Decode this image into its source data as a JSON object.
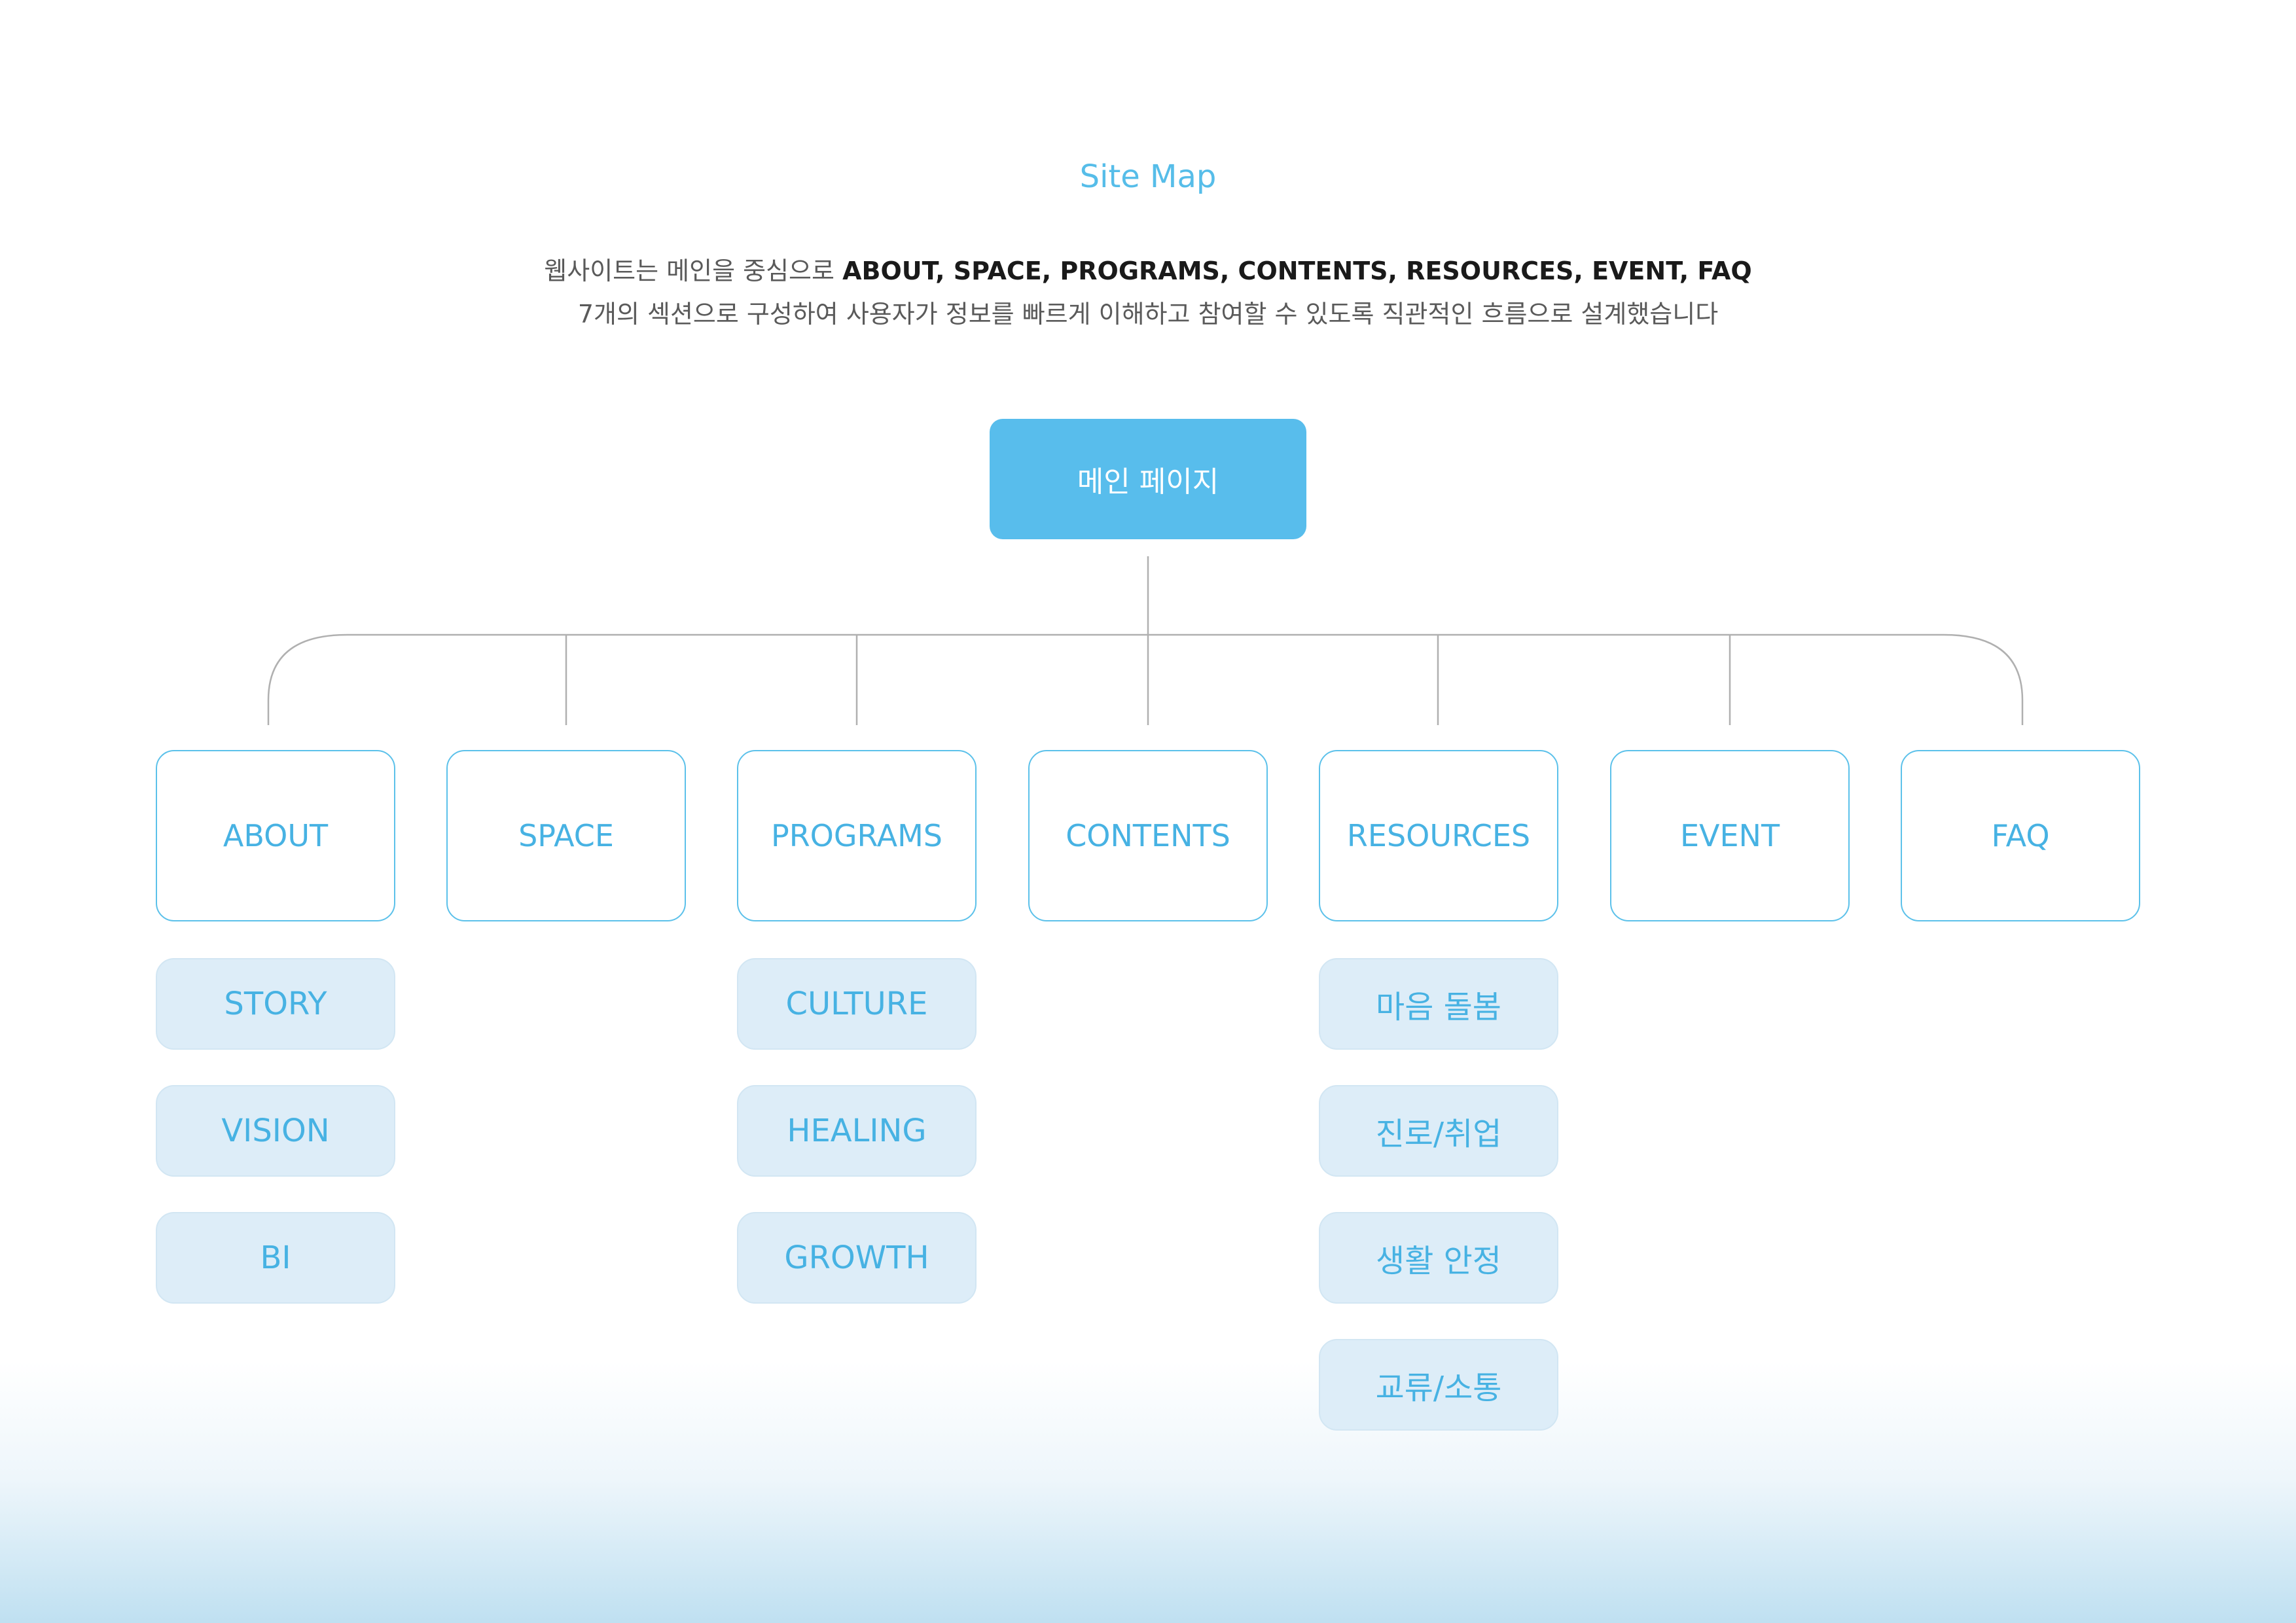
{
  "title": "Site Map",
  "description": {
    "line1_prefix": "웹사이트는 메인을 중심으로",
    "line1_bold": "ABOUT, SPACE, PROGRAMS, CONTENTS, RESOURCES, EVENT, FAQ",
    "line2": "7개의 섹션으로 구성하여 사용자가 정보를 빠르게 이해하고 참여할 수 있도록 직관적인 흐름으로 설계했습니다"
  },
  "main_node": "메인 페이지",
  "sections": [
    {
      "label": "ABOUT",
      "children": [
        "STORY",
        "VISION",
        "BI"
      ]
    },
    {
      "label": "SPACE",
      "children": []
    },
    {
      "label": "PROGRAMS",
      "children": [
        "CULTURE",
        "HEALING",
        "GROWTH"
      ]
    },
    {
      "label": "CONTENTS",
      "children": []
    },
    {
      "label": "RESOURCES",
      "children": [
        "마음 돌봄",
        "진로/취업",
        "생활 안정",
        "교류/소통"
      ]
    },
    {
      "label": "EVENT",
      "children": []
    },
    {
      "label": "FAQ",
      "children": []
    }
  ],
  "colors": {
    "accent": "#58bdec",
    "text_accent": "#47b2e3",
    "sub_fill": "#ddedf8",
    "connector": "#b0b0b0"
  }
}
